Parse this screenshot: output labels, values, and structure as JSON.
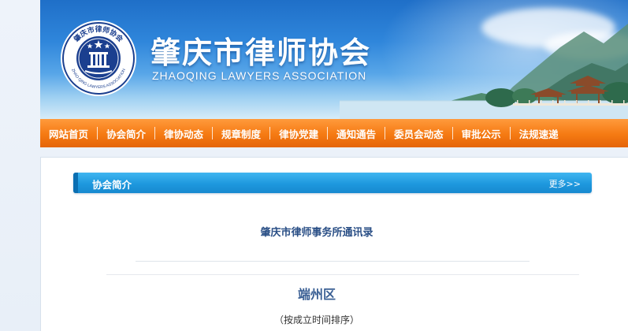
{
  "header": {
    "title_cn": "肇庆市律师协会",
    "title_en": "ZHAOQING LAWYERS ASSOCIATION",
    "emblem_text": "肇庆市律师协会",
    "emblem_text_en": "ZHAO QING LAWYERS ASSOCIATION"
  },
  "nav": {
    "items": [
      {
        "label": "网站首页"
      },
      {
        "label": "协会简介"
      },
      {
        "label": "律协动态"
      },
      {
        "label": "规章制度"
      },
      {
        "label": "律协党建"
      },
      {
        "label": "通知通告"
      },
      {
        "label": "委员会动态"
      },
      {
        "label": "审批公示"
      },
      {
        "label": "法规速递"
      }
    ]
  },
  "section": {
    "title": "协会简介",
    "more": "更多>>"
  },
  "article": {
    "title": "肇庆市律师事务所通讯录",
    "district": "端州区",
    "order_note": "（按成立时间排序）"
  },
  "colors": {
    "nav_orange": "#f57a12",
    "bar_blue": "#1e98de",
    "title_blue": "#2a4f86"
  }
}
